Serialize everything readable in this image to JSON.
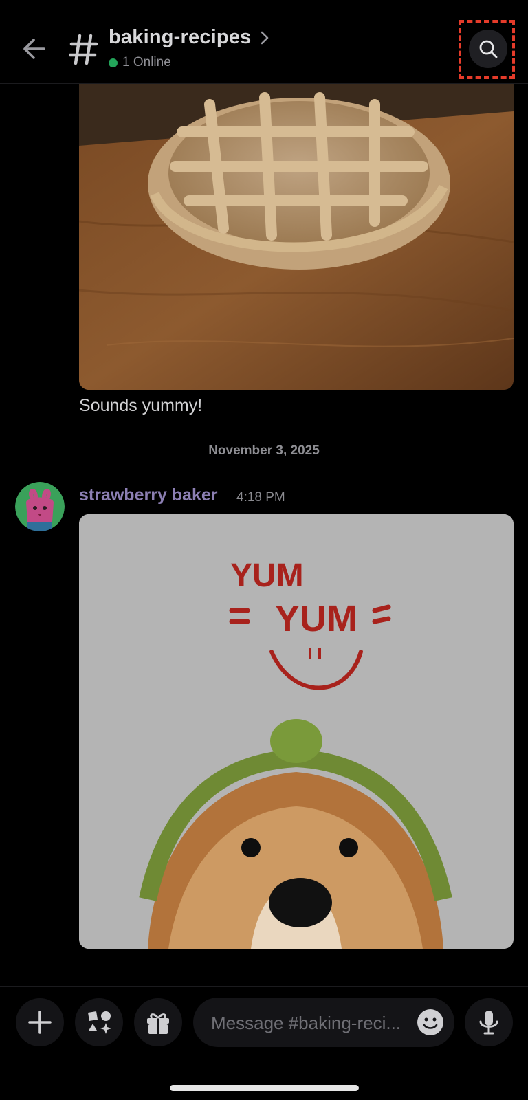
{
  "header": {
    "channel_name": "baking-recipes",
    "online_count": "1 Online",
    "online_color": "#23a55a",
    "icons": [
      "back-arrow-icon",
      "hash-icon",
      "chevron-right-icon",
      "search-icon"
    ]
  },
  "messages": {
    "first": {
      "image": "apple lattice pie on wooden board",
      "text": "Sounds yummy!"
    },
    "date_divider": "November 3, 2025",
    "second": {
      "author": "strawberry baker",
      "author_color": "#8c7fb3",
      "timestamp": "4:18 PM",
      "gif_text": [
        "YUM",
        "YUM"
      ]
    }
  },
  "composer": {
    "placeholder": "Message #baking-reci...",
    "icons": [
      "plus-icon",
      "apps-icon",
      "gift-icon",
      "emoji-icon",
      "microphone-icon"
    ]
  }
}
